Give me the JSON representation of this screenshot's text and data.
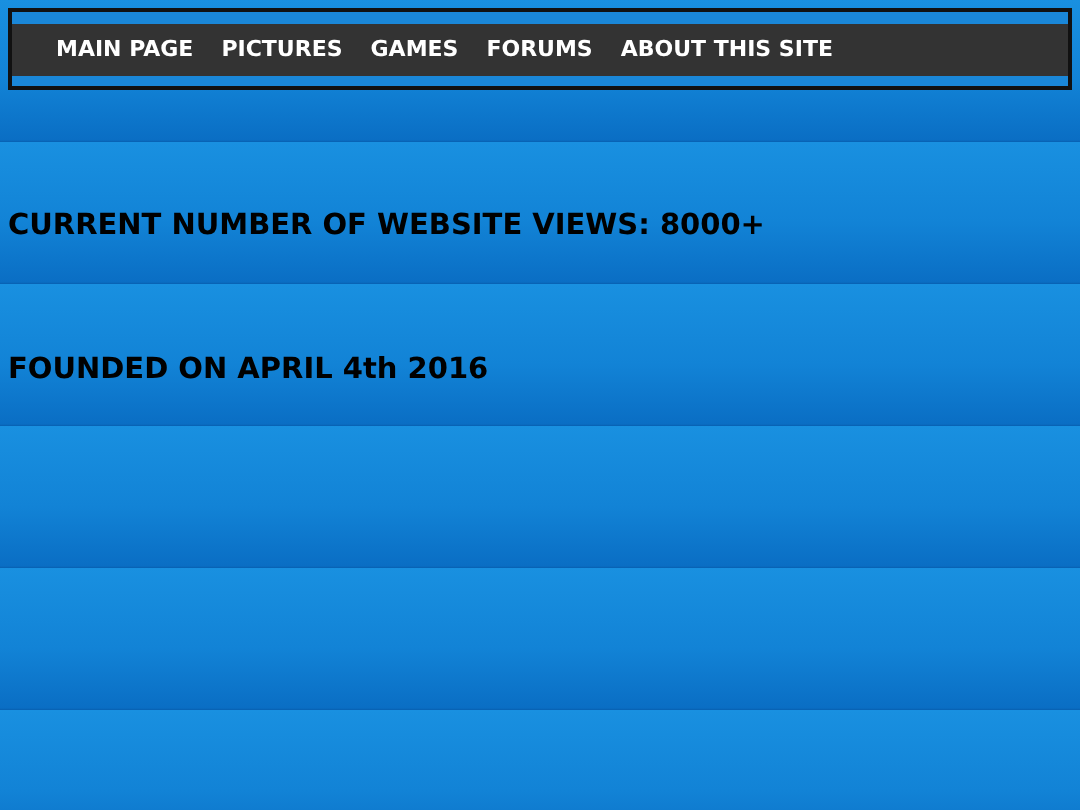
{
  "nav": {
    "items": [
      {
        "label": "MAIN PAGE"
      },
      {
        "label": "PICTURES"
      },
      {
        "label": "GAMES"
      },
      {
        "label": "FORUMS"
      },
      {
        "label": "ABOUT THIS SITE"
      }
    ]
  },
  "lines": [
    "CURRENT NUMBER OF WEBSITE VIEWS: 8000+",
    "FOUNDED ON APRIL 4th 2016"
  ]
}
